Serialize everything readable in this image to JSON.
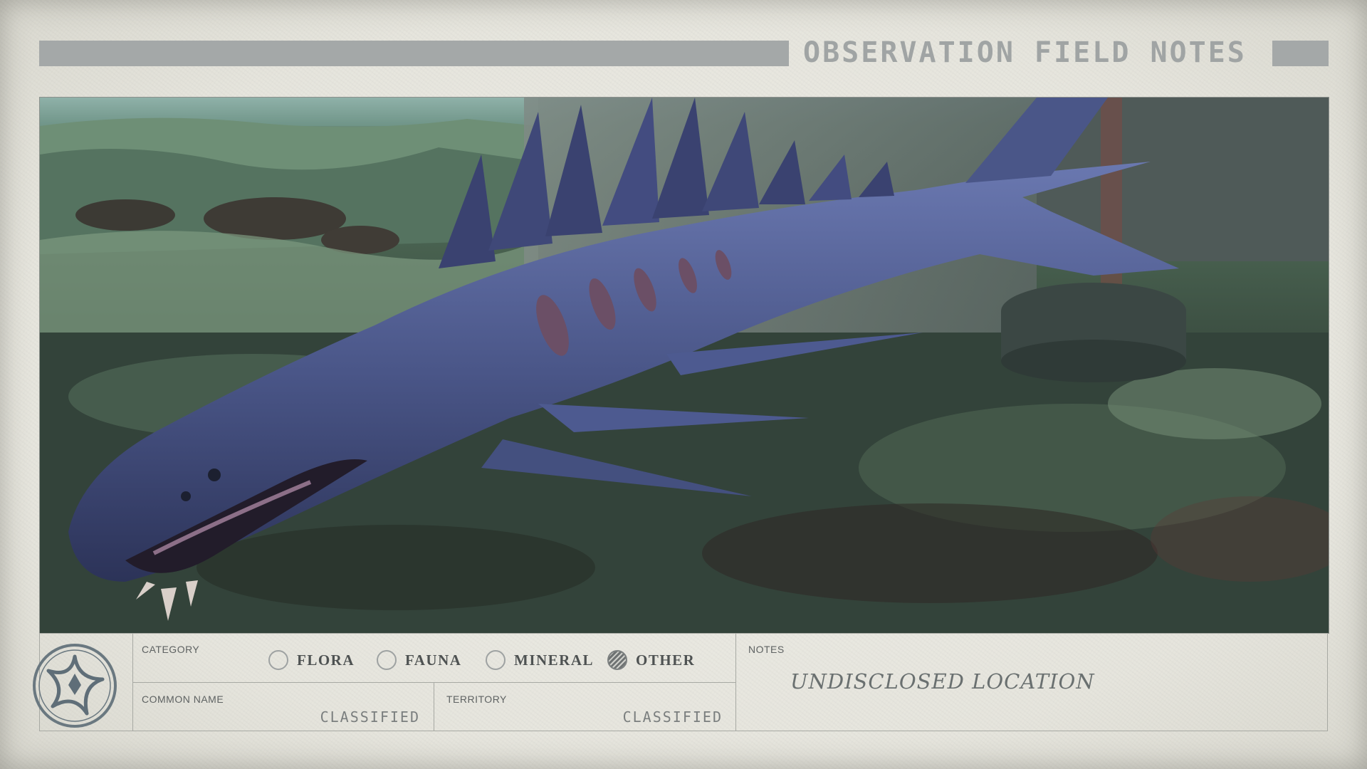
{
  "header": {
    "title": "OBSERVATION FIELD NOTES"
  },
  "photo": {
    "subject_icon": "creature-photo"
  },
  "emblem": {
    "icon": "star-compass-emblem-icon"
  },
  "category": {
    "label": "CATEGORY",
    "options": [
      {
        "label": "FLORA",
        "selected": false
      },
      {
        "label": "FAUNA",
        "selected": false
      },
      {
        "label": "MINERAL",
        "selected": false
      },
      {
        "label": "OTHER",
        "selected": true
      }
    ]
  },
  "common_name": {
    "label": "COMMON NAME",
    "value": "CLASSIFIED"
  },
  "territory": {
    "label": "TERRITORY",
    "value": "CLASSIFIED"
  },
  "notes": {
    "label": "NOTES",
    "value": "UNDISCLOSED LOCATION"
  },
  "colors": {
    "paper": "#e9e8e1",
    "header_bar": "#a4a8a8",
    "ink": "#4e5252",
    "creature": "#4a5688"
  }
}
